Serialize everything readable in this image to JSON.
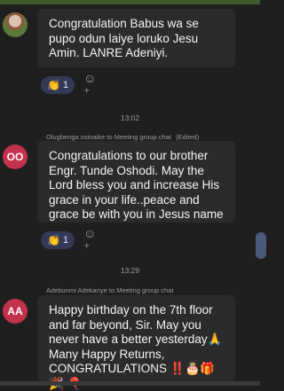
{
  "messages": [
    {
      "author_initials": "",
      "text": "Congratulation  Babus wa se pupo odun laiye loruko Jesu Amin. LANRE Adeniyi.",
      "reaction": {
        "icon": "clap-icon",
        "glyph": "👏",
        "count": "1"
      }
    },
    {
      "time": "13:02",
      "meta": "Olugbenga osinaike to Meeting group chat",
      "edited": "(Edited)",
      "author_initials": "OO",
      "text": "Congratulations to our brother Engr. Tunde Oshodi. May the Lord bless you and increase His grace in your life..peace and grace be with you in Jesus name",
      "reaction": {
        "icon": "clap-icon",
        "glyph": "👏",
        "count": "1"
      }
    },
    {
      "time": "13:29",
      "meta": "Adebunmi Adekanye to Meeting group chat",
      "author_initials": "AA",
      "text": "Happy birthday on the 7th floor and far beyond,  Sir. May you never have a better yesterday🙏 Many Happy Returns, CONGRATULATIONS ‼️🎂🎁🎉 🎈"
    }
  ],
  "add_reaction_glyph": "☺⁺"
}
